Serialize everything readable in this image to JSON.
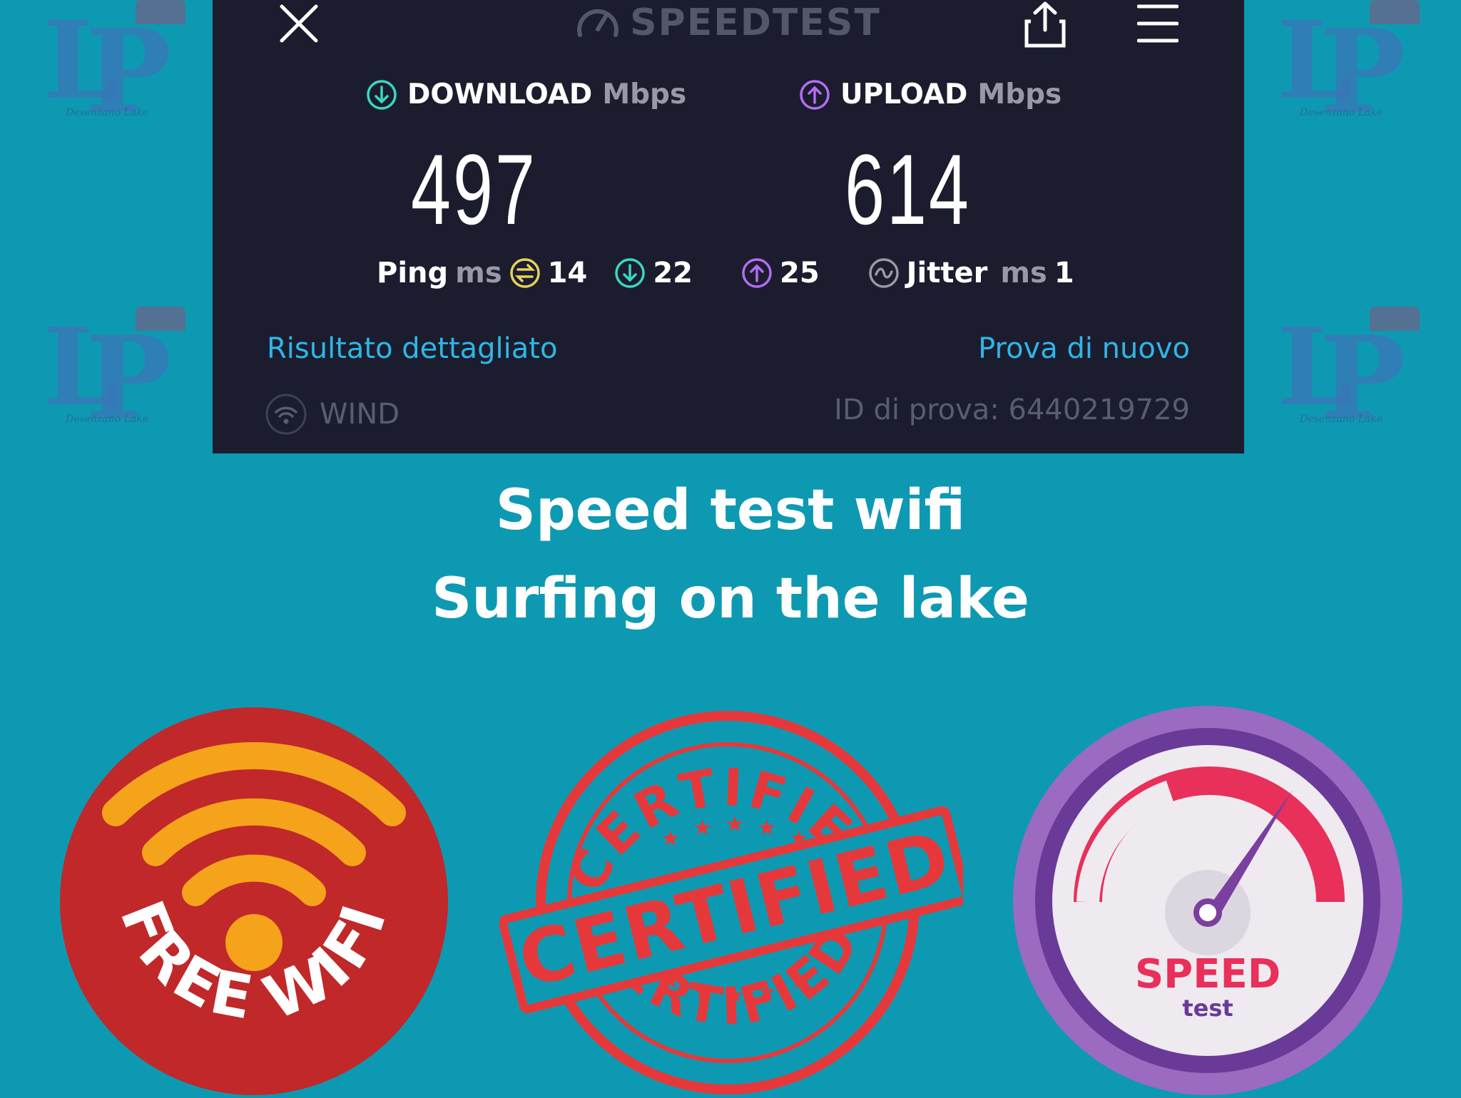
{
  "speedtest": {
    "brand": "SPEEDTEST",
    "download_label": "DOWNLOAD",
    "download_unit": "Mbps",
    "upload_label": "UPLOAD",
    "upload_unit": "Mbps",
    "download_value": "497",
    "upload_value": "614",
    "ping_label": "Ping",
    "ping_unit": "ms",
    "ping_idle": "14",
    "ping_download": "22",
    "ping_upload": "25",
    "jitter_label": "Jitter",
    "jitter_unit": "ms",
    "jitter_value": "1",
    "detail_link": "Risultato dettagliato",
    "retry_link": "Prova di nuovo",
    "provider": "WIND",
    "test_id": "ID di prova: 6440219729"
  },
  "caption": {
    "line1": "Speed test wifi",
    "line2": "Surfing on the lake"
  },
  "badges": {
    "free_wifi": "FREE WIFI",
    "certified_arc_top": "CERTIFIED",
    "certified_banner": "CERTIFIED",
    "certified_arc_bottom": "CERTIFIED",
    "speed_word": "SPEED",
    "speed_sub": "test"
  },
  "watermark": {
    "letters_left": "L",
    "letters_right": "P",
    "subtitle": "Desenzano Lake"
  },
  "colors": {
    "background": "#0e99b2",
    "panel": "#1b1d2e",
    "download_accent": "#3ad7c3",
    "upload_accent": "#b46cf2",
    "ping_idle_accent": "#e6d25a",
    "link": "#2fb6e6",
    "wifi_red": "#c0282a",
    "wifi_orange": "#f5a31b",
    "stamp_red": "#e6383a",
    "speed_red": "#e8305a",
    "speed_purple": "#7a3f9f"
  }
}
